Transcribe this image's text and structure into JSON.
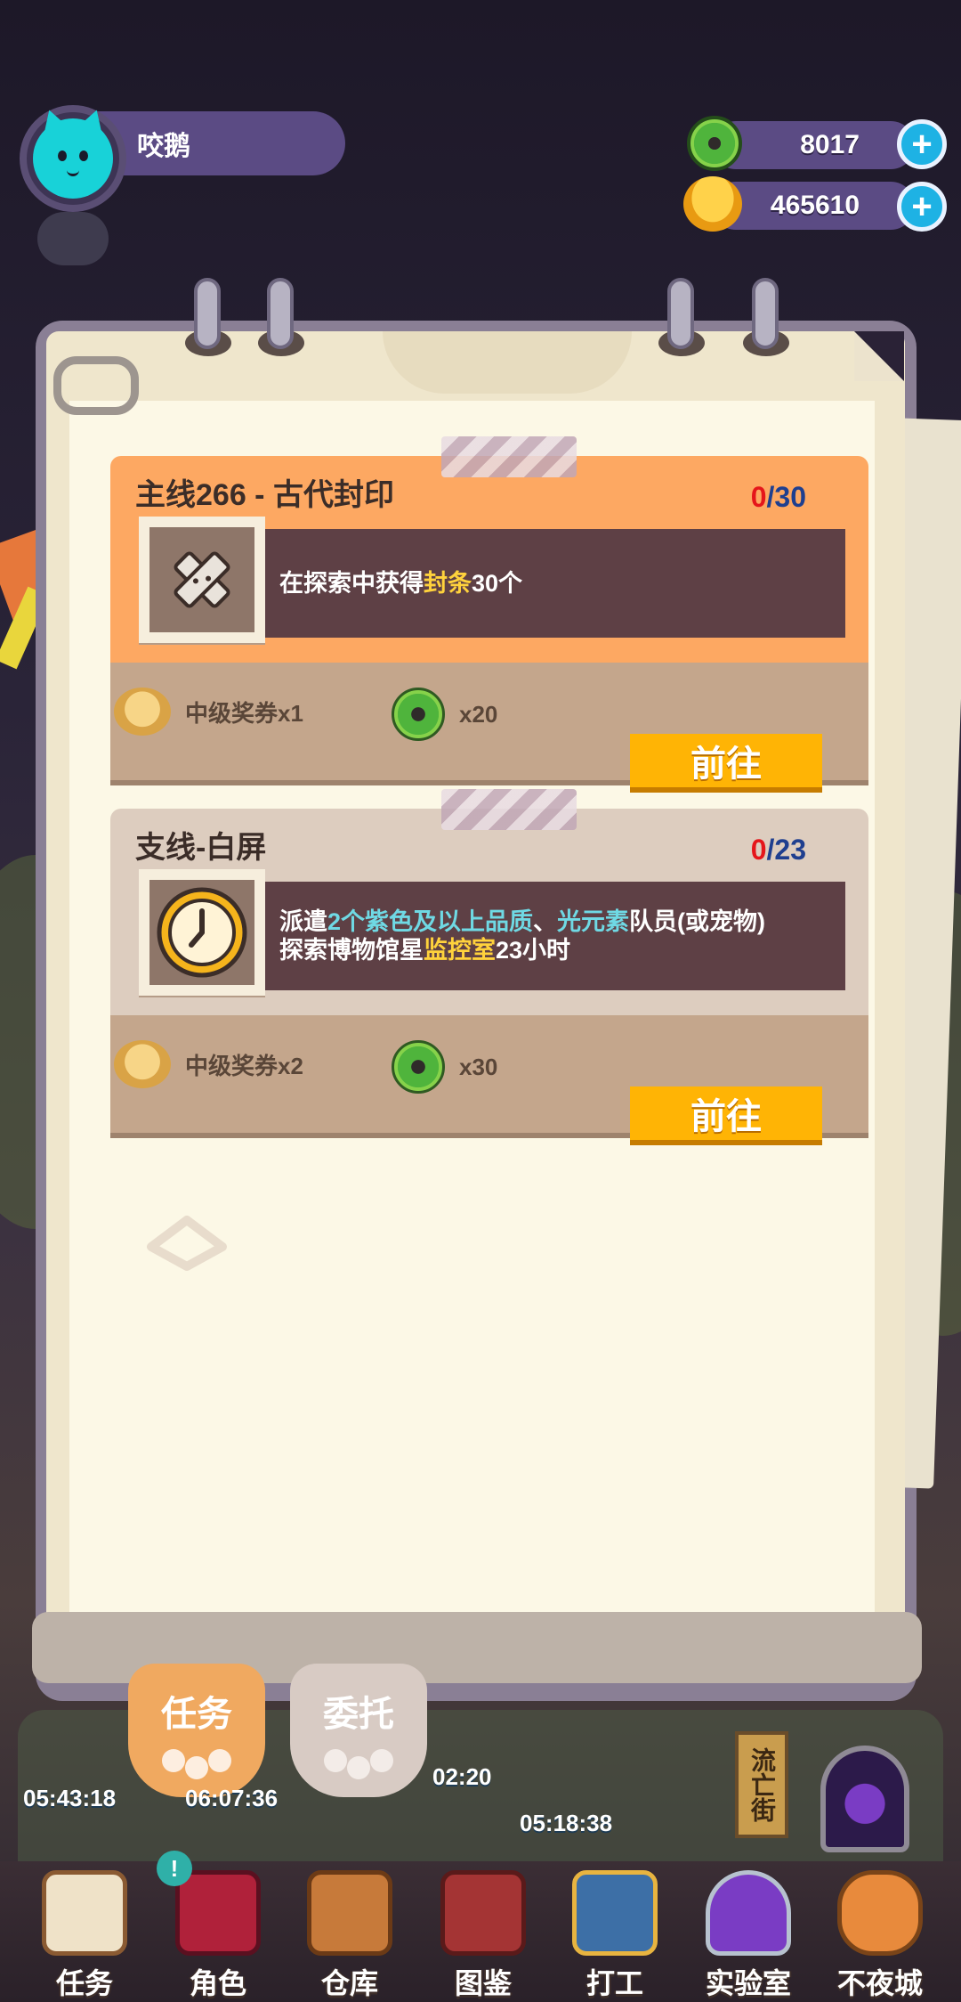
{
  "player": {
    "name": "咬鹅",
    "avatar_icon": "cat-avatar-icon"
  },
  "currencies": [
    {
      "icon": "donut-currency-icon",
      "value": "8017"
    },
    {
      "icon": "planet-coin-icon",
      "value": "465610"
    }
  ],
  "quests": [
    {
      "title": "主线266 - 古代封印",
      "progress_current": "0",
      "progress_total": "/30",
      "head_color": "#fda862",
      "icon": "seal-tape-icon",
      "desc_a": "在探索中获得",
      "desc_hl": "封条",
      "desc_b": "30个",
      "reward1_label": "中级奖券x1",
      "reward2_label": "x20",
      "go_label": "前往"
    },
    {
      "title": "支线-白屏",
      "progress_current": "0",
      "progress_total": "/23",
      "head_color": "#ddcdbf",
      "icon": "clock-icon",
      "desc_l1_a": "派遣",
      "desc_l1_hl1": "2个紫色及以上品质",
      "desc_l1_b": "、",
      "desc_l1_hl2": "光元素",
      "desc_l1_c": "队员(或宠物)",
      "desc_l2_a": "探索博物馆星",
      "desc_l2_hl": "监控室",
      "desc_l2_b": "23小时",
      "reward1_label": "中级奖券x2",
      "reward2_label": "x30",
      "go_label": "前往"
    }
  ],
  "tabs": [
    {
      "label": "任务",
      "active": true
    },
    {
      "label": "委托",
      "active": false
    }
  ],
  "timers": [
    "05:43:18",
    "06:07:36",
    "02:20",
    "05:18:38"
  ],
  "street_sign": "流亡街",
  "bottom_nav": [
    {
      "label": "任务",
      "icon": "clipboard-icon"
    },
    {
      "label": "角色",
      "icon": "character-book-icon"
    },
    {
      "label": "仓库",
      "icon": "chest-icon"
    },
    {
      "label": "图鉴",
      "icon": "encyclopedia-icon"
    },
    {
      "label": "打工",
      "icon": "work-icon"
    },
    {
      "label": "实验室",
      "icon": "lab-icon"
    },
    {
      "label": "不夜城",
      "icon": "night-city-icon"
    }
  ]
}
